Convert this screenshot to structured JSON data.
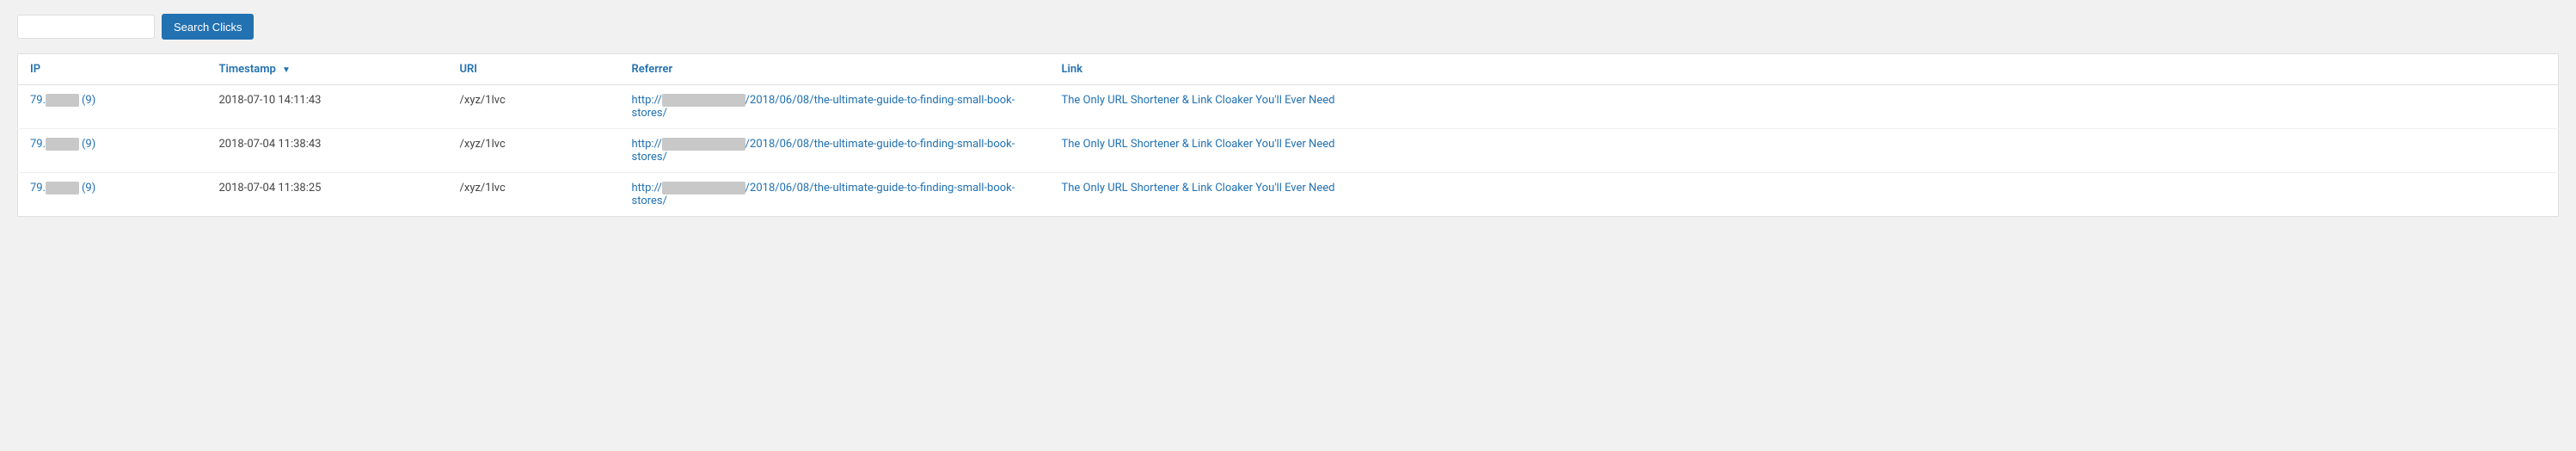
{
  "search": {
    "input_placeholder": "",
    "button_label": "Search Clicks"
  },
  "table": {
    "columns": [
      {
        "key": "ip",
        "label": "IP",
        "sorted": false
      },
      {
        "key": "timestamp",
        "label": "Timestamp",
        "sorted": true,
        "sort_dir": "▼"
      },
      {
        "key": "uri",
        "label": "URI",
        "sorted": false
      },
      {
        "key": "referrer",
        "label": "Referrer",
        "sorted": false
      },
      {
        "key": "link",
        "label": "Link",
        "sorted": false
      }
    ],
    "rows": [
      {
        "ip_prefix": "79.",
        "ip_blurred": "████████",
        "ip_count": "(9)",
        "timestamp": "2018-07-10 14:11:43",
        "uri": "/xyz/1lvc",
        "referrer_prefix": "http://",
        "referrer_blurred": "████████████████████████",
        "referrer_suffix": "/2018/06/08/the-ultimate-guide-to-finding-small-book-stores/",
        "link": "The Only URL Shortener & Link Cloaker You'll Ever Need"
      },
      {
        "ip_prefix": "79.",
        "ip_blurred": "████████",
        "ip_count": "(9)",
        "timestamp": "2018-07-04 11:38:43",
        "uri": "/xyz/1lvc",
        "referrer_prefix": "http://",
        "referrer_blurred": "████████████████████████",
        "referrer_suffix": "/2018/06/08/the-ultimate-guide-to-finding-small-book-stores/",
        "link": "The Only URL Shortener & Link Cloaker You'll Ever Need"
      },
      {
        "ip_prefix": "79.",
        "ip_blurred": "████████",
        "ip_count": "(9)",
        "timestamp": "2018-07-04 11:38:25",
        "uri": "/xyz/1lvc",
        "referrer_prefix": "http://",
        "referrer_blurred": "████████████████████████",
        "referrer_suffix": "/2018/06/08/the-ultimate-guide-to-finding-small-book-stores/",
        "link": "The Only URL Shortener & Link Cloaker You'll Ever Need"
      }
    ]
  }
}
